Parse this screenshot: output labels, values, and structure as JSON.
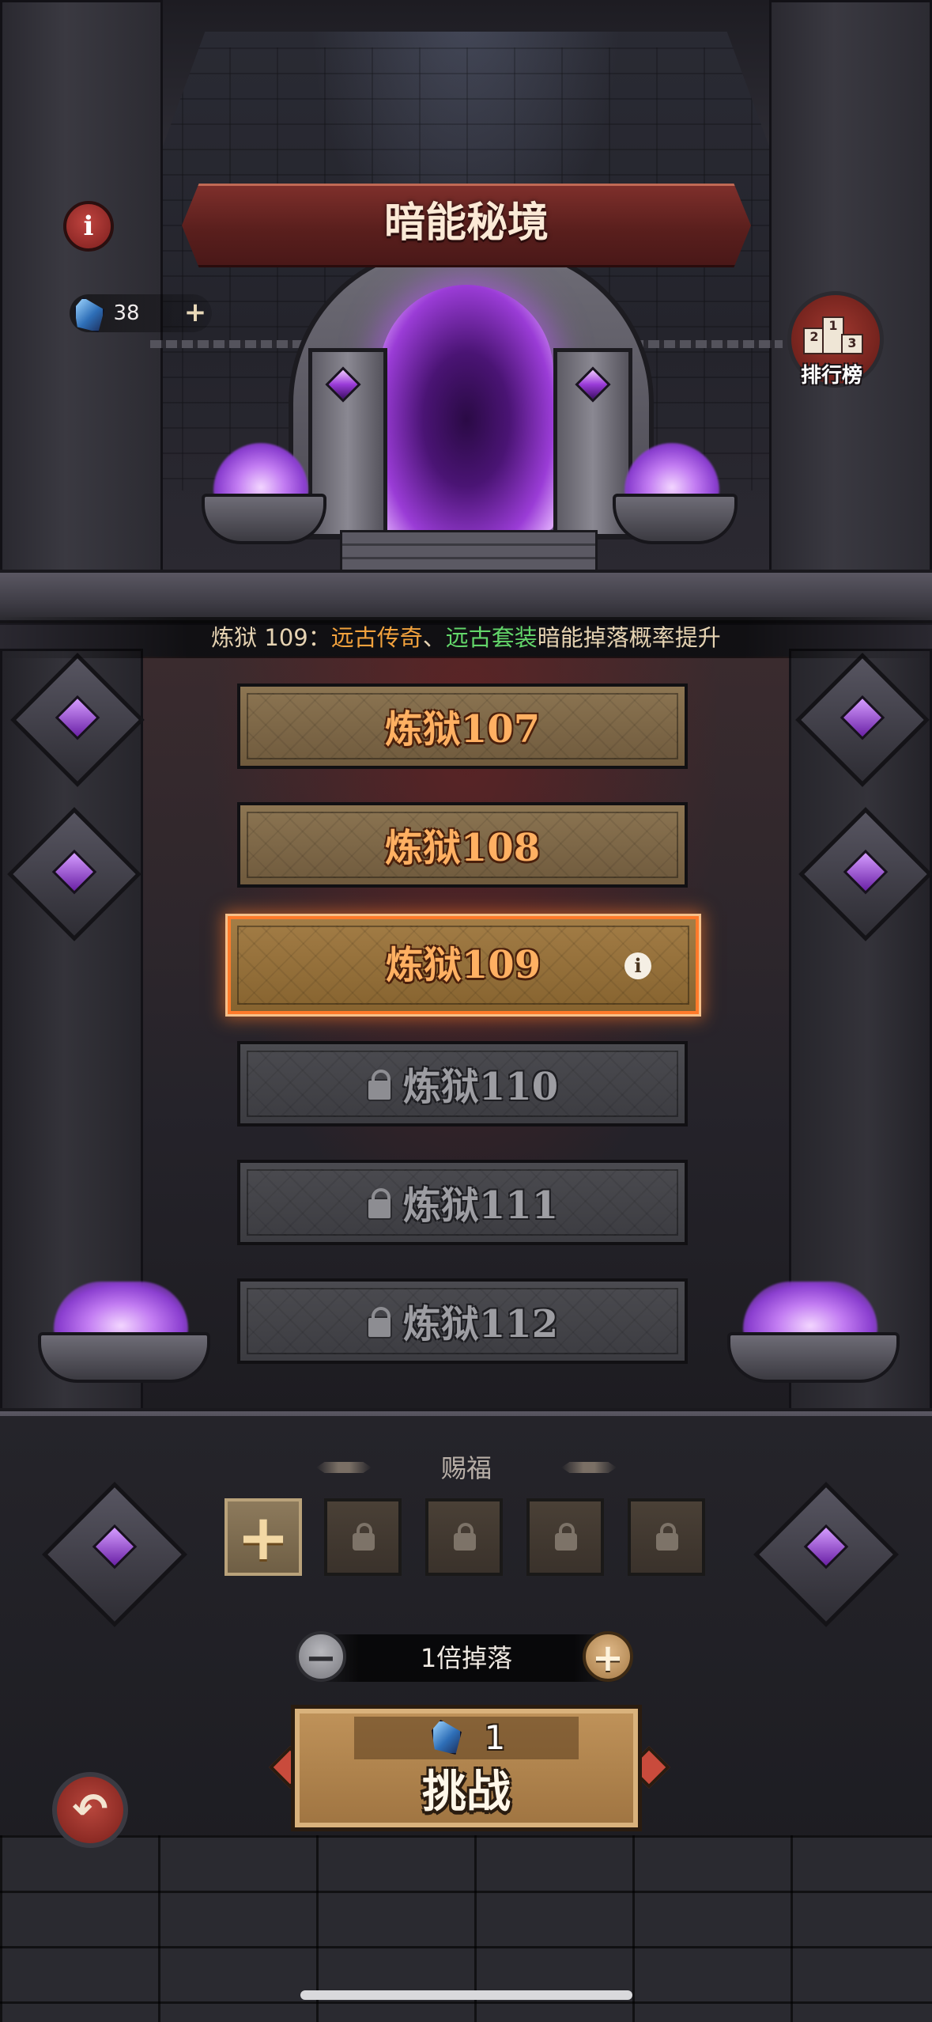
{
  "header": {
    "title": "暗能秘境",
    "info_icon": "i"
  },
  "currency": {
    "icon": "blue-crystal-icon",
    "value": "38",
    "plus": "+"
  },
  "ranking": {
    "label": "排行榜",
    "podium": [
      "2",
      "1",
      "3"
    ]
  },
  "hint": {
    "prefix": "炼狱 109：",
    "item1": "远古传奇",
    "sep": "、",
    "item2": "远古套装",
    "suffix": "暗能掉落概率提升"
  },
  "floors": [
    {
      "label": "炼狱107",
      "state": "unlocked"
    },
    {
      "label": "炼狱108",
      "state": "unlocked"
    },
    {
      "label": "炼狱109",
      "state": "selected",
      "info_icon": "i"
    },
    {
      "label": "炼狱110",
      "state": "locked"
    },
    {
      "label": "炼狱111",
      "state": "locked"
    },
    {
      "label": "炼狱112",
      "state": "locked"
    }
  ],
  "blessing": {
    "title": "赐福",
    "add_label": "+",
    "slots": [
      "add",
      "locked",
      "locked",
      "locked",
      "locked"
    ]
  },
  "multiplier": {
    "label": "1倍掉落",
    "minus": "−",
    "plus": "+"
  },
  "challenge": {
    "cost": "1",
    "label": "挑战"
  },
  "back": {
    "icon": "back-arrow-icon",
    "glyph": "↶"
  },
  "colors": {
    "accent_orange": "#f2a23d",
    "accent_green": "#63d66a",
    "portal_purple": "#9a3cd6",
    "selected_border": "#ff7a2a"
  }
}
